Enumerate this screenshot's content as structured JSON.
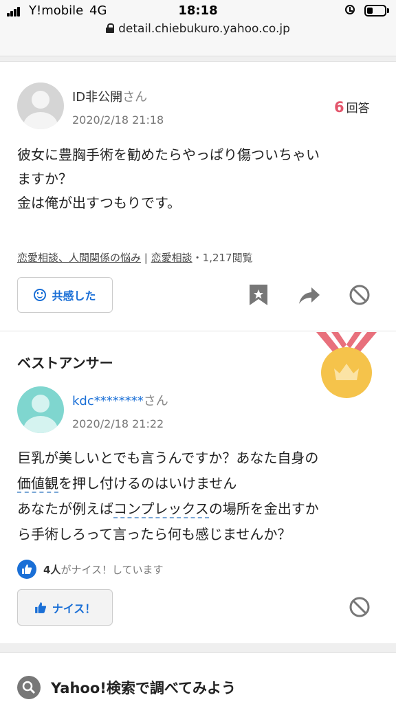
{
  "status_bar": {
    "carrier": "Y!mobile",
    "network": "4G",
    "time": "18:18",
    "battery_level": 0.35
  },
  "browser": {
    "url": "detail.chiebukuro.yahoo.co.jp"
  },
  "question": {
    "user_name": "ID非公開",
    "user_suffix": "さん",
    "date": "2020/2/18 21:18",
    "answer_count": "6",
    "answer_label": "回答",
    "text_lines": [
      "彼女に豊胸手術を勧めたらやっぱり傷ついちゃい",
      "ますか？",
      "金は俺が出すつもりです。"
    ],
    "category_1": "恋愛相談、人間関係の悩み",
    "category_separator": "|",
    "category_2": "恋愛相談",
    "views": "・1,217閲覧",
    "empathy_button": "共感した"
  },
  "best_answer": {
    "title": "ベストアンサー",
    "user_name": "kdc********",
    "user_suffix": "さん",
    "date": "2020/2/18 21:22",
    "text": {
      "l1": "巨乳が美しいとでも言うんですか？あなた自身の",
      "l2_linked": "価値観",
      "l2_rest": "を押し付けるのはいけません",
      "l3_pre": "あなたが例えば",
      "l3_linked": "コンプレックス",
      "l3_post": "の場所を金出すか",
      "l4": "ら手術しろって言ったら何も感じませんか？"
    },
    "nice_count": "4人",
    "nice_text": "がナイス！しています",
    "nice_button": "ナイス！"
  },
  "footer": {
    "search_title": "Yahoo!検索で調べてみよう"
  },
  "colors": {
    "accent_blue": "#1a6fd6",
    "answer_count_red": "#e3566c",
    "medal_gold": "#f5c34b",
    "ribbon_pink": "#e8707c"
  }
}
